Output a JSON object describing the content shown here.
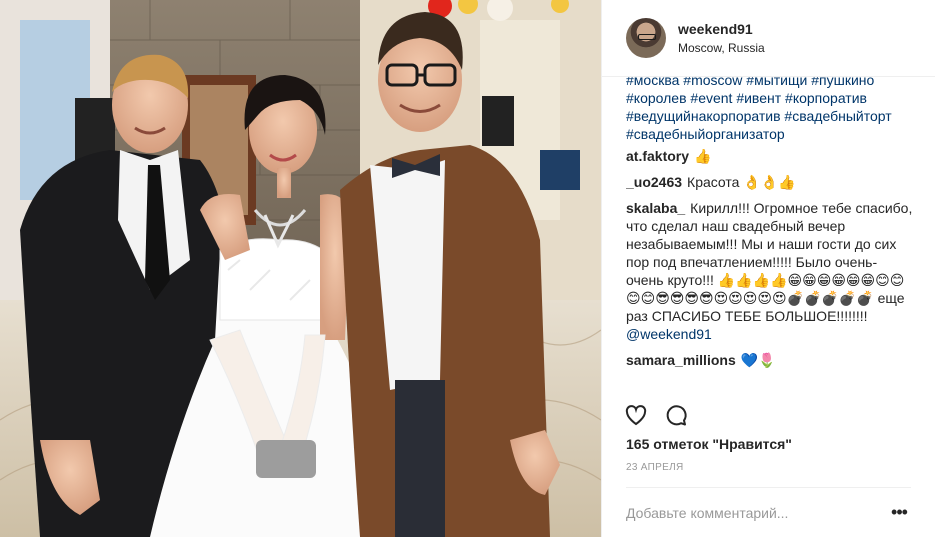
{
  "post": {
    "username": "weekend91",
    "location": "Moscow, Russia",
    "photo_alt": "Photo"
  },
  "hashtags": [
    "#москва #moscow #мытищи #пушкино",
    "#королев #event #ивент #корпоратив",
    "#ведущийнакорпоратив #свадебныйторт",
    "#свадебныйорганизатор"
  ],
  "comments": [
    {
      "user": "at.faktory",
      "text": "👍"
    },
    {
      "user": "_uo2463",
      "text": "Красота 👌👌👍"
    },
    {
      "user": "skalaba_",
      "text": "Кирилл!!! Огромное тебе спасибо, что сделал наш свадебный вечер незабываемым!!! Мы и наши гости до сих пор под впечатлением!!!!! Было очень- очень круто!!! 👍👍👍👍😁😁😁😁😁😁😊😊😊😊😎😎😎😎😍😍😍😍😍💣💣💣💣💣 еще раз СПАСИБО ТЕБЕ БОЛЬШОЕ!!!!!!!!",
      "mention": "@weekend91"
    },
    {
      "user": "samara_millions",
      "text": "💙🌷"
    }
  ],
  "likes": "165 отметок \"Нравится\"",
  "date": "23 АПРЕЛЯ",
  "add_comment_placeholder": "Добавьте комментарий...",
  "more_label": "•••",
  "icons": [
    "heart-icon",
    "comment-icon",
    "more-icon"
  ]
}
